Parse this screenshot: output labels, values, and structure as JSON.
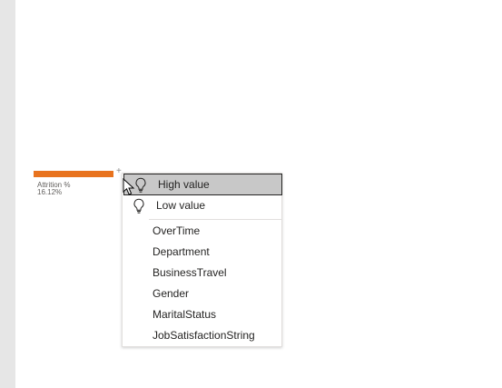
{
  "node": {
    "label": "Attrition %",
    "value": "16.12%",
    "expand_glyph": "+",
    "bar_color": "#e8731e"
  },
  "menu": {
    "ai_items": [
      {
        "label": "High value",
        "icon": "lightbulb-icon",
        "selected": true
      },
      {
        "label": "Low value",
        "icon": "lightbulb-icon",
        "selected": false
      }
    ],
    "fields": [
      "OverTime",
      "Department",
      "BusinessTravel",
      "Gender",
      "MaritalStatus",
      "JobSatisfactionString"
    ]
  }
}
